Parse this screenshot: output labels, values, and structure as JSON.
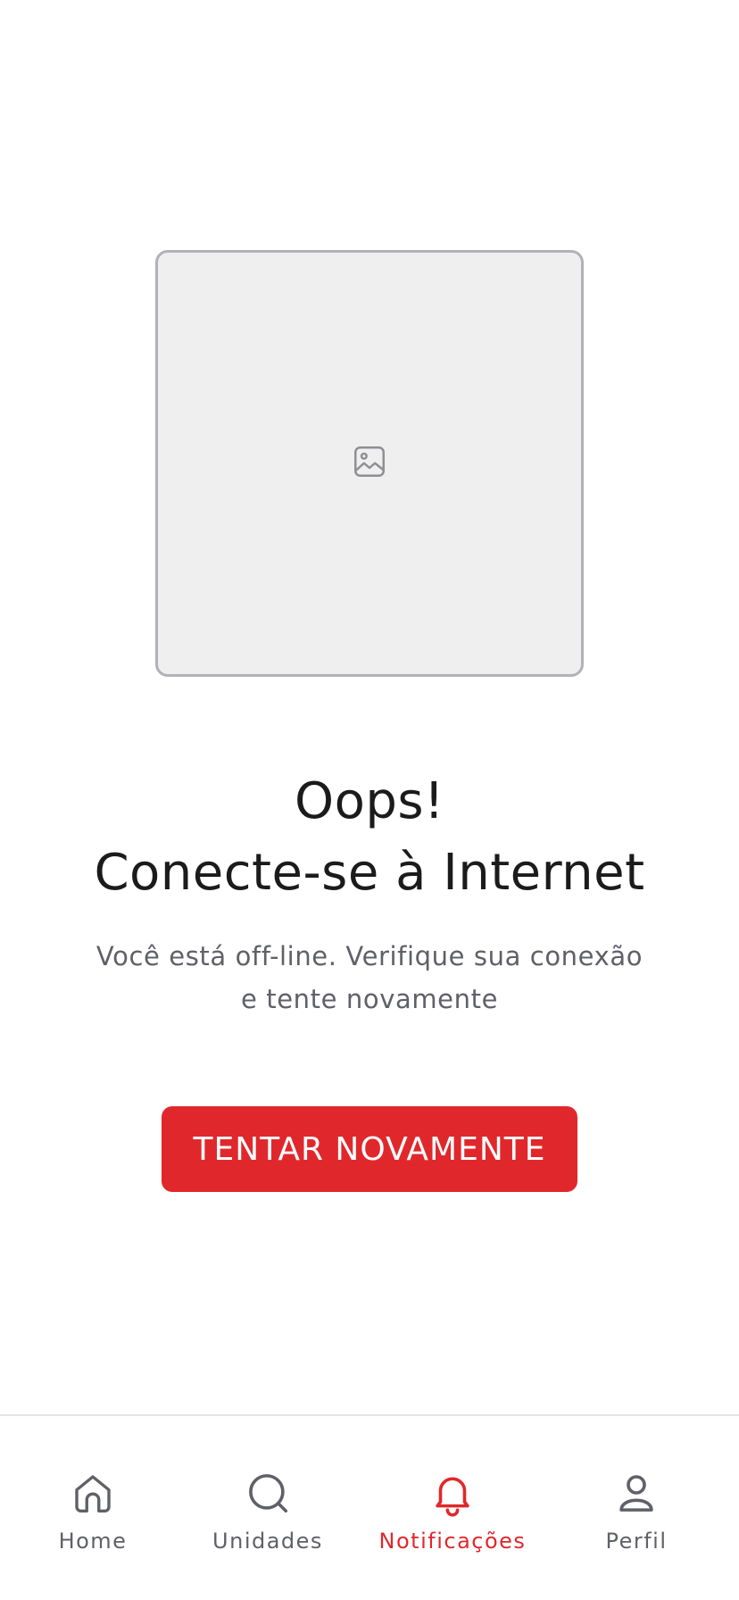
{
  "colors": {
    "accent": "#e0282c",
    "text_primary": "#1b1b1b",
    "text_secondary": "#5f6068",
    "placeholder_bg": "#efefef",
    "placeholder_border": "#b1b1b7"
  },
  "error": {
    "image_icon": "image-placeholder-icon",
    "title_line1": "Oops!",
    "title_line2": "Conecte-se à Internet",
    "message": "Você está off-line. Verifique sua conexão e tente novamente",
    "retry_label": "TENTAR NOVAMENTE"
  },
  "tabbar": {
    "items": [
      {
        "label": "Home",
        "icon": "home-icon",
        "active": false
      },
      {
        "label": "Unidades",
        "icon": "search-icon",
        "active": false
      },
      {
        "label": "Notificações",
        "icon": "bell-icon",
        "active": true
      },
      {
        "label": "Perfil",
        "icon": "user-icon",
        "active": false
      }
    ]
  }
}
